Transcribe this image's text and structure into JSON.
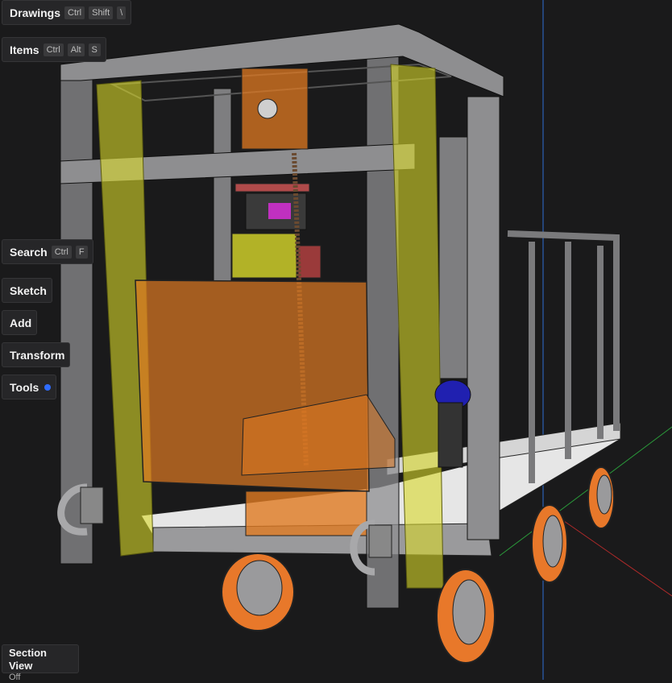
{
  "toolbar": {
    "drawings": {
      "label": "Drawings",
      "keys": [
        "Ctrl",
        "Shift",
        "\\"
      ]
    },
    "items": {
      "label": "Items",
      "keys": [
        "Ctrl",
        "Alt",
        "S"
      ]
    },
    "search": {
      "label": "Search",
      "keys": [
        "Ctrl",
        "F"
      ]
    },
    "sketch": {
      "label": "Sketch"
    },
    "add": {
      "label": "Add"
    },
    "transform": {
      "label": "Transform"
    },
    "tools": {
      "label": "Tools"
    }
  },
  "section_view": {
    "label": "Section View",
    "value": "Off"
  },
  "colors": {
    "background": "#1a1a1b",
    "frame": "#8e8e90",
    "rail_yellow": "#d8d82a",
    "orange_box": "#e07a22",
    "wheel_orange": "#e8782a",
    "deck": "#e6e6e6",
    "tools_indicator": "#2f6cff"
  },
  "scene": {
    "name": "3D cart model with vertical lift frame"
  }
}
